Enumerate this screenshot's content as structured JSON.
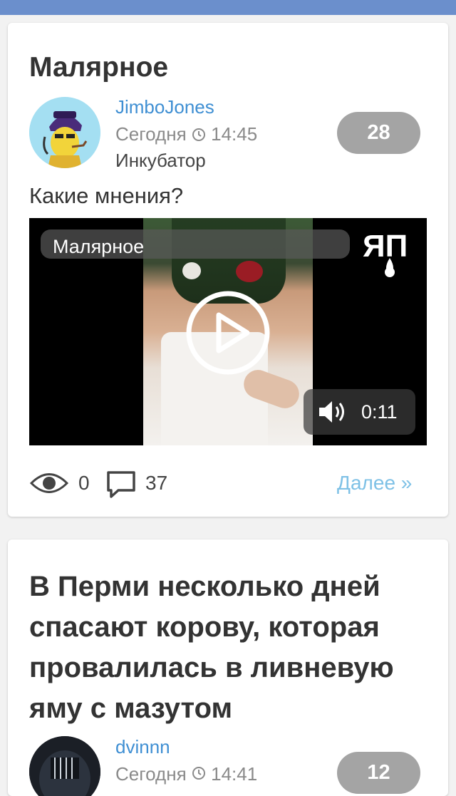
{
  "posts": [
    {
      "title": "Малярное",
      "author": "JimboJones",
      "date": "Сегодня",
      "time": "14:45",
      "community": "Инкубатор",
      "rating": "28",
      "excerpt": "Какие мнения?",
      "video": {
        "title": "Малярное",
        "duration": "0:11",
        "logo": "ЯП"
      },
      "views": "0",
      "comments": "37",
      "more_label": "Далее »"
    },
    {
      "title": "В Перми несколько дней спасают корову, которая провалилась в ливневую яму с мазутом",
      "author": "dvinnn",
      "date": "Сегодня",
      "time": "14:41",
      "rating": "12"
    }
  ],
  "icons": {
    "clock": "clock-icon",
    "play": "play-icon",
    "sound": "volume-icon",
    "views": "eye-icon",
    "comments": "comment-icon"
  },
  "colors": {
    "topbar": "#6b8fcc",
    "link": "#3f8fd3",
    "more": "#7ec1e6",
    "badge": "#a4a4a4"
  }
}
